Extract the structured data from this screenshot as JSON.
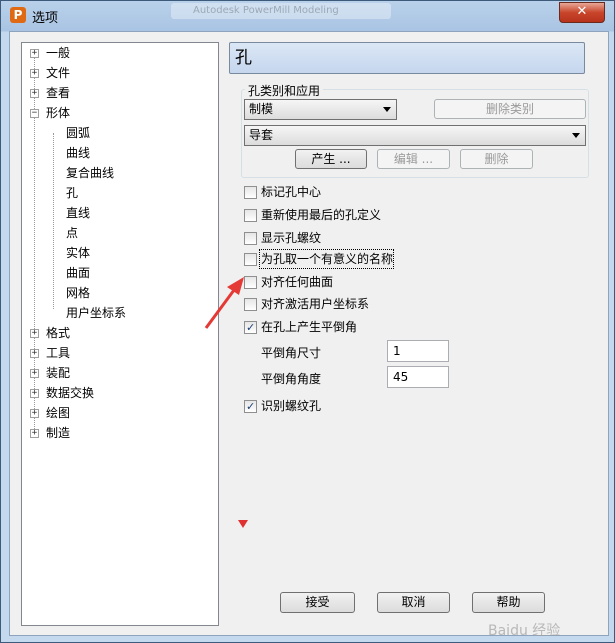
{
  "window": {
    "title": "选项",
    "app_icon": "P",
    "background_tab": "Autodesk PowerMill Modeling",
    "close_icon": "close-icon"
  },
  "tree": {
    "items": [
      {
        "label": "一般",
        "expander": "+"
      },
      {
        "label": "文件",
        "expander": "+"
      },
      {
        "label": "查看",
        "expander": "+"
      },
      {
        "label": "形体",
        "expander": "−"
      },
      {
        "label": "圆弧"
      },
      {
        "label": "曲线"
      },
      {
        "label": "复合曲线"
      },
      {
        "label": "孔"
      },
      {
        "label": "直线"
      },
      {
        "label": "点"
      },
      {
        "label": "实体"
      },
      {
        "label": "曲面"
      },
      {
        "label": "网格"
      },
      {
        "label": "用户坐标系"
      },
      {
        "label": "格式",
        "expander": "+"
      },
      {
        "label": "工具",
        "expander": "+"
      },
      {
        "label": "装配",
        "expander": "+"
      },
      {
        "label": "数据交换",
        "expander": "+"
      },
      {
        "label": "绘图",
        "expander": "+"
      },
      {
        "label": "制造",
        "expander": "+"
      }
    ]
  },
  "panel": {
    "title": "孔",
    "group": {
      "label": "孔类别和应用",
      "type_combo": "制模",
      "delete_type_button": "删除类别",
      "application_combo": "导套",
      "create_button": "产生 ...",
      "edit_button": "编辑 ...",
      "delete_button": "删除"
    },
    "options": [
      {
        "label": "标记孔中心",
        "checked": false
      },
      {
        "label": "重新使用最后的孔定义",
        "checked": false
      },
      {
        "label": "显示孔螺纹",
        "checked": false
      },
      {
        "label": "为孔取一个有意义的名称",
        "checked": false
      },
      {
        "label": "对齐任何曲面",
        "checked": false
      },
      {
        "label": "对齐激活用户坐标系",
        "checked": false
      },
      {
        "label": "在孔上产生平倒角",
        "checked": true
      }
    ],
    "chamfer_size_label": "平倒角尺寸",
    "chamfer_size_value": "1",
    "chamfer_angle_label": "平倒角角度",
    "chamfer_angle_value": "45",
    "recognize_thread": {
      "label": "识别螺纹孔",
      "checked": true
    }
  },
  "footer": {
    "accept_button": "接受",
    "cancel_button": "取消",
    "help_button": "帮助"
  },
  "watermark": "Baidu 经验",
  "colors": {
    "annotation_arrow": "#e53935",
    "check_tick": "#1a3f75"
  }
}
